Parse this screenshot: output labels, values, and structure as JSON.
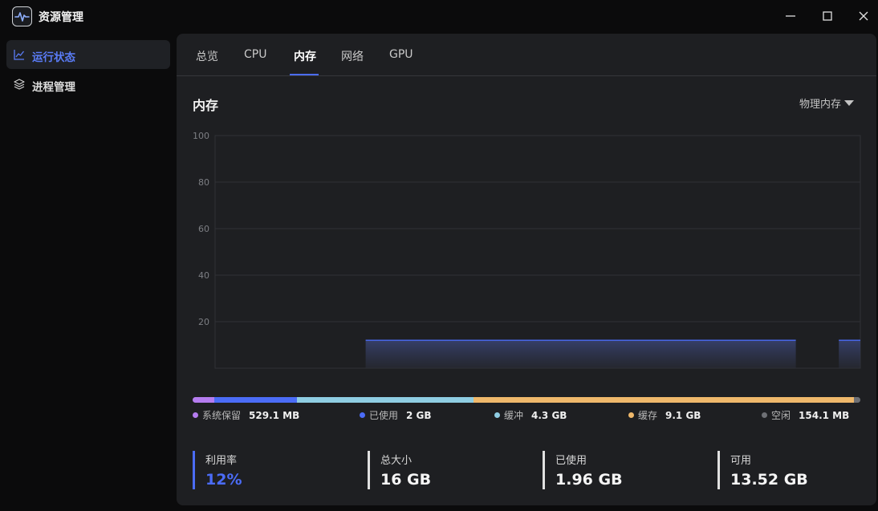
{
  "app": {
    "title": "资源管理",
    "icon": "pulse-monitor-icon"
  },
  "window": {
    "controls": [
      "minimize",
      "maximize",
      "close"
    ]
  },
  "sidebar": {
    "items": [
      {
        "label": "运行状态",
        "icon": "line-chart-icon",
        "active": true
      },
      {
        "label": "进程管理",
        "icon": "layers-icon",
        "active": false
      }
    ]
  },
  "tabs": [
    {
      "label": "总览",
      "active": false
    },
    {
      "label": "CPU",
      "active": false
    },
    {
      "label": "内存",
      "active": true
    },
    {
      "label": "网络",
      "active": false
    },
    {
      "label": "GPU",
      "active": false
    }
  ],
  "section": {
    "title": "内存",
    "dropdown_label": "物理内存"
  },
  "chart_data": {
    "type": "area",
    "ylim": [
      0,
      100
    ],
    "yticks": [
      "100",
      "80",
      "60",
      "40",
      "20"
    ],
    "grid": true,
    "series": [
      {
        "values": [
          null,
          null,
          null,
          null,
          null,
          null,
          null,
          12,
          12,
          12,
          12,
          12,
          12,
          12,
          12,
          12,
          12,
          12,
          12,
          12,
          12,
          12,
          12,
          12,
          12,
          12,
          12,
          12,
          null,
          12,
          12
        ]
      }
    ],
    "color": "#4b6cf7"
  },
  "memory": {
    "legend": [
      {
        "label": "系统保留",
        "value": "529.1 MB",
        "color": "#b57cf0",
        "fraction": 0.033
      },
      {
        "label": "已使用",
        "value": "2 GB",
        "color": "#4b6cf7",
        "fraction": 0.123
      },
      {
        "label": "缓冲",
        "value": "4.3 GB",
        "color": "#8fcde3",
        "fraction": 0.265
      },
      {
        "label": "缓存",
        "value": "9.1 GB",
        "color": "#efb86b",
        "fraction": 0.57
      },
      {
        "label": "空闲",
        "value": "154.1 MB",
        "color": "#6e7075",
        "fraction": 0.009
      }
    ]
  },
  "stats": [
    {
      "label": "利用率",
      "value": "12%"
    },
    {
      "label": "总大小",
      "value": "16 GB"
    },
    {
      "label": "已使用",
      "value": "1.96 GB"
    },
    {
      "label": "可用",
      "value": "13.52 GB"
    }
  ]
}
